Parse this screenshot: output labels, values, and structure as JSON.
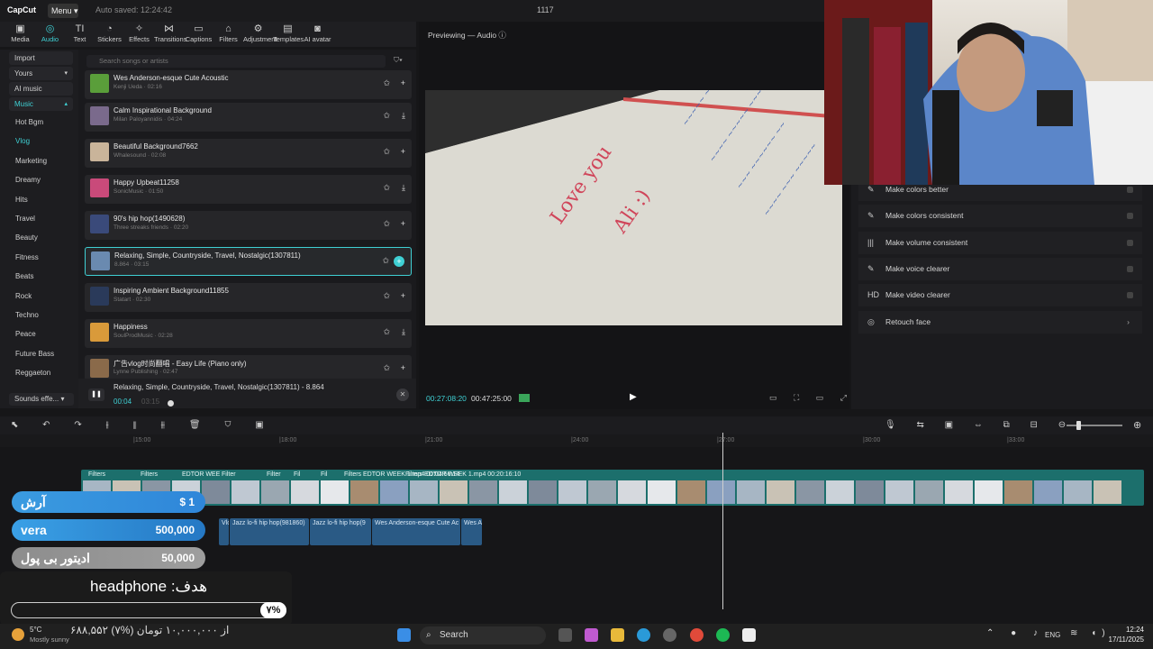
{
  "topbar": {
    "logo": "CapCut",
    "menu": "Menu ▾",
    "autosave": "Auto saved: 12:24:42",
    "title": "1117"
  },
  "tools": [
    {
      "icon": "▣",
      "label": "Media"
    },
    {
      "icon": "◎",
      "label": "Audio"
    },
    {
      "icon": "TI",
      "label": "Text"
    },
    {
      "icon": "◔",
      "label": "Stickers"
    },
    {
      "icon": "✧",
      "label": "Effects"
    },
    {
      "icon": "⋈",
      "label": "Transitions"
    },
    {
      "icon": "▭",
      "label": "Captions"
    },
    {
      "icon": "⌂",
      "label": "Filters"
    },
    {
      "icon": "⚙",
      "label": "Adjustment"
    },
    {
      "icon": "▤",
      "label": "Templates"
    },
    {
      "icon": "◙",
      "label": "AI avatar"
    }
  ],
  "sidebar": [
    "Import",
    "Yours",
    "AI music",
    "Music",
    "Hot Bgm",
    "Vlog",
    "Marketing",
    "Dreamy",
    "Hits",
    "Travel",
    "Beauty",
    "Fitness",
    "Beats",
    "Rock",
    "Techno",
    "Peace",
    "Future Bass",
    "Reggaeton"
  ],
  "sidebar_footer": "Sounds effe...",
  "search_placeholder": "Search songs or artists",
  "songs": [
    {
      "title": "Wes Anderson-esque Cute Acoustic",
      "sub": "Kenji Ueda · 02:16",
      "color": "#5a9e3a"
    },
    {
      "title": "Calm Inspirational Background",
      "sub": "Milan Paloyannidis · 04:24",
      "color": "#7a6a8c"
    },
    {
      "title": "Beautiful Background7662",
      "sub": "Whalesound · 02:08",
      "color": "#c9b49a"
    },
    {
      "title": "Happy Upbeat11258",
      "sub": "SonicMusic · 01:50",
      "color": "#c94a7a"
    },
    {
      "title": "90's hip hop(1490628)",
      "sub": "Three streaks friends · 02:20",
      "color": "#3a4a7a"
    },
    {
      "title": "Relaxing, Simple, Countryside, Travel, Nostalgic(1307811)",
      "sub": "8.864 · 03:15",
      "color": "#6a8ab0"
    },
    {
      "title": "Inspiring Ambient Background11855",
      "sub": "Statart · 02:30",
      "color": "#2a3a5a"
    },
    {
      "title": "Happiness",
      "sub": "SoulProdMusic · 02:28",
      "color": "#d99a3a"
    },
    {
      "title": "广告vlog时尚翻唱 - Easy Life (Piano only)",
      "sub": "Lynne Publishing · 02:47",
      "color": "#8a6a4a"
    }
  ],
  "nowplaying": {
    "title": "Relaxing, Simple, Countryside, Travel, Nostalgic(1307811) - 8.864",
    "time": "00:04",
    "total": "03:15"
  },
  "preview": {
    "title": "Previewing — Audio ⓘ",
    "time": "00:27:08:20",
    "duration": "00:47:25:00"
  },
  "right_items": [
    "Make colors better",
    "Make colors consistent",
    "Make volume consistent",
    "Make voice clearer",
    "Make video clearer",
    "Retouch face"
  ],
  "right_icons": [
    "✎",
    "✎",
    "|||",
    "✎",
    "HD",
    "◎"
  ],
  "ruler": [
    "|15:00",
    "|18:00",
    "|21:00",
    "|24:00",
    "|27:00",
    "|30:00",
    "|33:00"
  ],
  "track_labels": [
    "Filters",
    "Filters",
    "EDTOR WEE",
    "Filter",
    "Filter",
    "Fil",
    "Fil",
    "Filters EDTOR WEEK 1.mp4  00:04:56:14",
    "Filters  EDTOR WEEK 1.mp4  00:20:16:10"
  ],
  "audio_clips": [
    "Vlo",
    "Jazz lo-fi hip hop(981860)",
    "Jazz lo-fi hip hop(9",
    "Wes Anderson-esque Cute Ac",
    "Wes A"
  ],
  "donations": [
    {
      "name": "آرش",
      "value": "$ 1"
    },
    {
      "name": "vera",
      "value": "500,000"
    },
    {
      "name": "ادیتور بی پول",
      "value": "50,000"
    }
  ],
  "goal": {
    "text": "headphone :هدف",
    "percent": "٧%",
    "ticker": "۶۸۸,۵۵۲ از ۱۰,۰۰۰,۰۰۰ تومان (%۷)",
    "fill": 0.07
  },
  "taskbar": {
    "temp": "5°C",
    "weather": "Mostly sunny",
    "search": "Search",
    "lang": "ENG",
    "time": "12:24",
    "date": "17/11/2025"
  }
}
